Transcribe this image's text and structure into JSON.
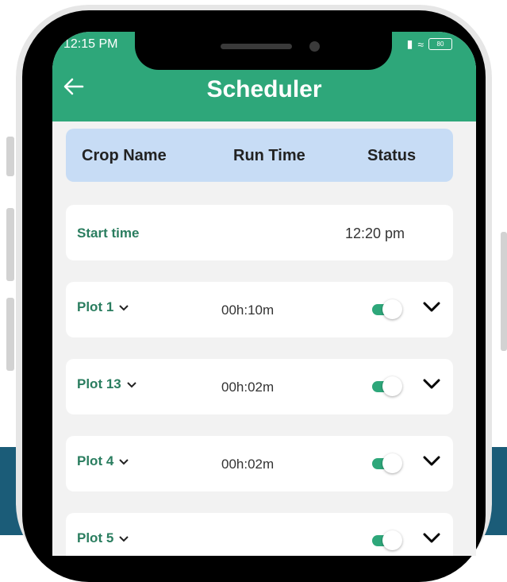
{
  "status_bar": {
    "time": "12:15 PM",
    "battery": "80"
  },
  "app_bar": {
    "title": "Scheduler"
  },
  "table_header": {
    "crop_name": "Crop Name",
    "run_time": "Run Time",
    "status": "Status"
  },
  "start_time": {
    "label": "Start time",
    "value": "12:20 pm"
  },
  "plots": [
    {
      "name": "Plot 1",
      "run_time": "00h:10m",
      "enabled": true
    },
    {
      "name": "Plot 13",
      "run_time": "00h:02m",
      "enabled": true
    },
    {
      "name": "Plot 4",
      "run_time": "00h:02m",
      "enabled": true
    },
    {
      "name": "Plot 5",
      "run_time": "",
      "enabled": true
    }
  ],
  "colors": {
    "accent": "#2ea77a",
    "header_bg": "#c7dcf5",
    "label_green": "#2a7d5f"
  }
}
